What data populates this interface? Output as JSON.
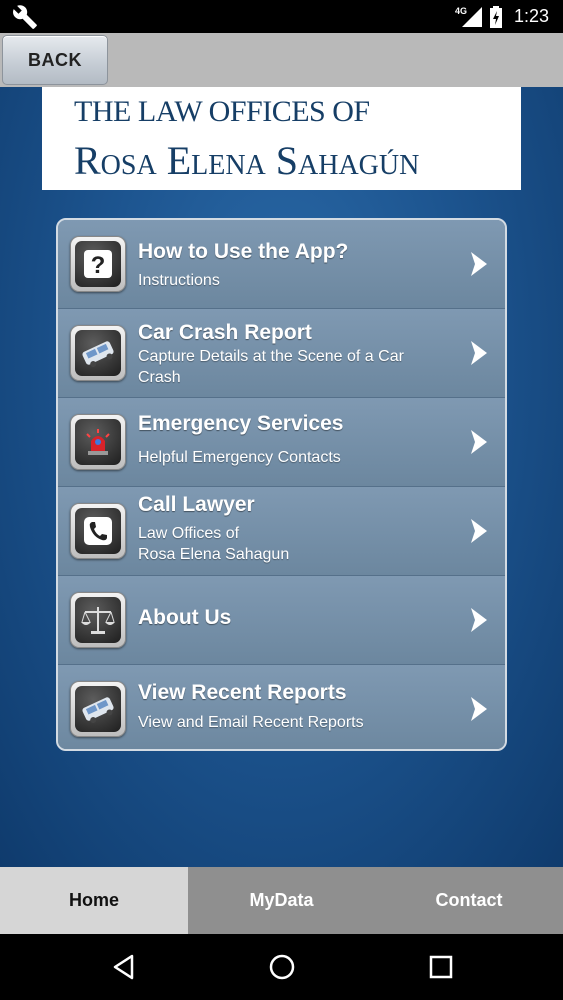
{
  "status_bar": {
    "network_type": "4G",
    "time": "1:23"
  },
  "header": {
    "back_label": "BACK"
  },
  "logo": {
    "line1": "THE LAW OFFICES OF",
    "line2": "Rosa Elena Sahagún"
  },
  "menu": {
    "items": [
      {
        "title": "How to Use the App?",
        "subtitle": "Instructions",
        "icon": "question-icon"
      },
      {
        "title": "Car Crash Report",
        "subtitle": "Capture Details at the Scene of a Car Crash",
        "icon": "crash-car-icon"
      },
      {
        "title": "Emergency Services",
        "subtitle": "Helpful Emergency Contacts",
        "icon": "siren-icon"
      },
      {
        "title": "Call Lawyer",
        "subtitle_line1": "Law Offices of",
        "subtitle_line2": "Rosa Elena Sahagun",
        "icon": "phone-icon"
      },
      {
        "title": "About Us",
        "subtitle": "",
        "icon": "scales-icon"
      },
      {
        "title": "View Recent Reports",
        "subtitle": "View and Email Recent Reports",
        "icon": "crash-car-icon"
      }
    ]
  },
  "tabs": {
    "home": "Home",
    "mydata": "MyData",
    "contact": "Contact",
    "active": "home"
  },
  "colors": {
    "background_blue": "#1d5590",
    "panel": "#7f99b2",
    "logo_text": "#163e66"
  }
}
